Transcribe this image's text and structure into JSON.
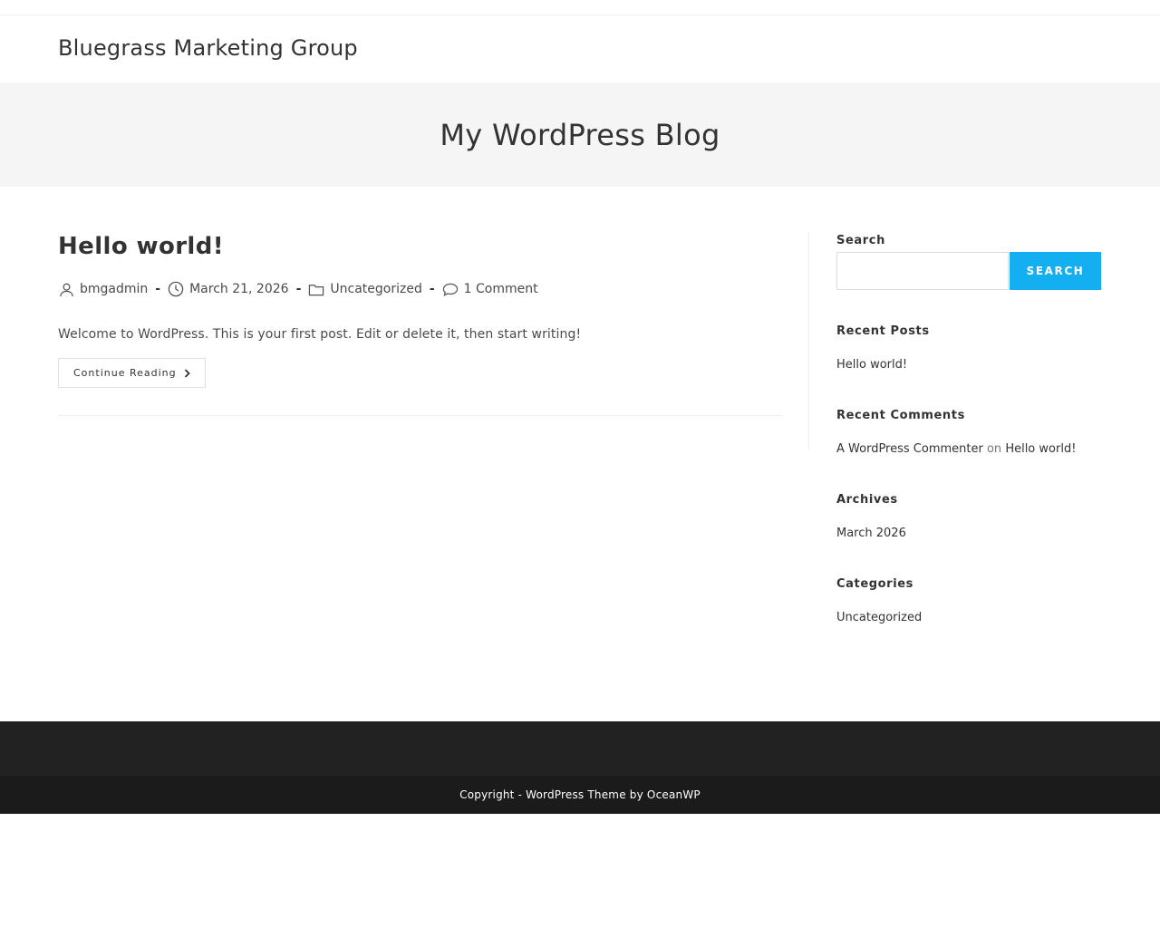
{
  "site": {
    "title": "Bluegrass Marketing Group"
  },
  "page_header": {
    "title": "My WordPress Blog"
  },
  "post": {
    "title": "Hello world!",
    "author": "bmgadmin",
    "date": "March 21, 2026",
    "category": "Uncategorized",
    "comments": "1 Comment",
    "separator": "-",
    "excerpt": "Welcome to WordPress. This is your first post. Edit or delete it, then start writing!",
    "continue_label": "Continue Reading"
  },
  "sidebar": {
    "search": {
      "title": "Search",
      "value": "",
      "button_label": "SEARCH"
    },
    "recent_posts": {
      "title": "Recent Posts",
      "items": [
        "Hello world!"
      ]
    },
    "recent_comments": {
      "title": "Recent Comments",
      "author": "A WordPress Commenter",
      "on_word": "on",
      "post": "Hello world!"
    },
    "archives": {
      "title": "Archives",
      "items": [
        "March 2026"
      ]
    },
    "categories": {
      "title": "Categories",
      "items": [
        "Uncategorized"
      ]
    }
  },
  "footer": {
    "copyright": "Copyright - WordPress Theme by OceanWP"
  },
  "colors": {
    "accent": "#13aff0",
    "footer_dark": "#222222",
    "footer_bottom": "#1b1b1b",
    "page_header_bg": "#f5f5f5"
  },
  "icons": {
    "author": "user-icon",
    "date": "clock-icon",
    "category": "folder-icon",
    "comments": "comment-icon",
    "continue": "chevron-right-icon"
  }
}
